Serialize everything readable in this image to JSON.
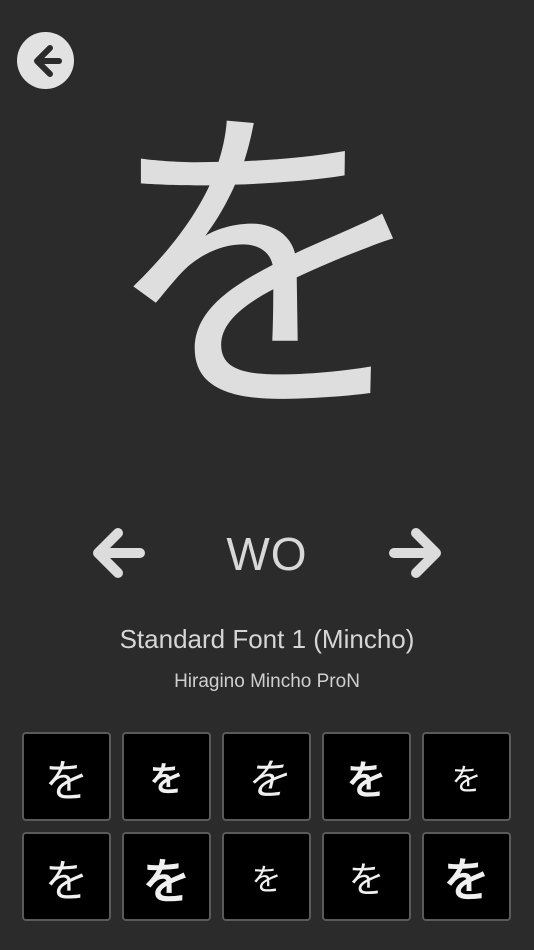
{
  "character": {
    "kana": "を",
    "romaji": "WO"
  },
  "font": {
    "title": "Standard Font 1 (Mincho)",
    "subtitle": "Hiragino Mincho ProN"
  },
  "icons": {
    "back": "back-arrow-icon",
    "prev": "left-arrow-icon",
    "next": "right-arrow-icon"
  },
  "font_tiles": [
    {
      "glyph": "を"
    },
    {
      "glyph": "を"
    },
    {
      "glyph": "を"
    },
    {
      "glyph": "を"
    },
    {
      "glyph": "を"
    },
    {
      "glyph": "を"
    },
    {
      "glyph": "を"
    },
    {
      "glyph": "を"
    },
    {
      "glyph": "を"
    },
    {
      "glyph": "を"
    }
  ],
  "colors": {
    "background": "#2b2b2b",
    "foreground": "#dedede",
    "tile_bg": "#000000",
    "tile_border": "#5a5a5a"
  }
}
